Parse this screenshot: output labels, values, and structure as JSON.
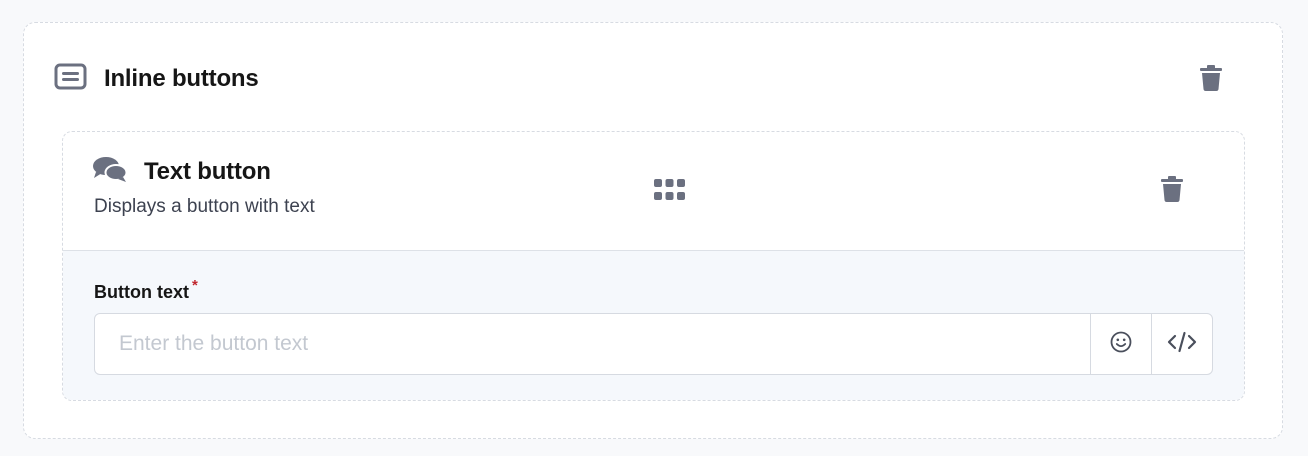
{
  "block": {
    "title": "Inline buttons",
    "icon": "list-box-icon",
    "delete_icon": "trash-icon"
  },
  "button_item": {
    "title": "Text button",
    "subtitle": "Displays a button with text",
    "icon": "chat-bubbles-icon",
    "drag_icon": "grid-dots-icon",
    "delete_icon": "trash-icon",
    "field": {
      "label": "Button text",
      "required_mark": "*",
      "value": "",
      "placeholder": "Enter the button text",
      "addons": [
        "emoji-icon",
        "code-icon"
      ]
    }
  },
  "colors": {
    "icon_gray": "#6b7080",
    "required_red": "#c0262d",
    "body_bg": "#f5f8fc"
  }
}
